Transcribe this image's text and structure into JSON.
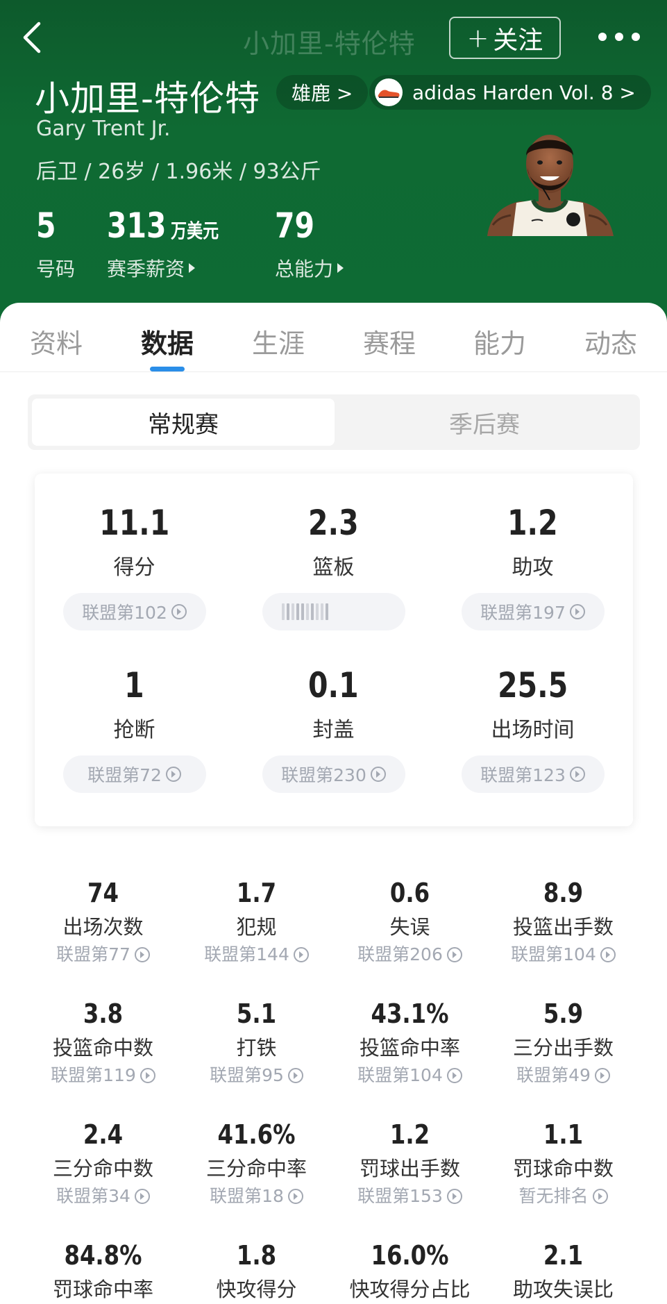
{
  "header": {
    "ghost_title": "小加里-特伦特",
    "follow_label": "关注",
    "player_name_cn": "小加里-特伦特",
    "team_chip": "雄鹿 >",
    "shoe_chip": "adidas Harden Vol. 8 >",
    "player_name_en": "Gary Trent Jr.",
    "meta": "后卫 / 26岁 / 1.96米 / 93公斤",
    "stats": {
      "number": {
        "value": "5",
        "label": "号码"
      },
      "salary": {
        "value": "313",
        "unit": "万美元",
        "label": "赛季薪资"
      },
      "rating": {
        "value": "79",
        "label": "总能力"
      }
    },
    "colors": {
      "bg": "#0e6b34",
      "accent": "#2a8ee8"
    }
  },
  "tabs": [
    "资料",
    "数据",
    "生涯",
    "赛程",
    "能力",
    "动态"
  ],
  "active_tab": "数据",
  "segments": {
    "regular": "常规赛",
    "playoffs": "季后赛"
  },
  "main_stats": [
    {
      "value": "11.1",
      "label": "得分",
      "rank": "联盟第102"
    },
    {
      "value": "2.3",
      "label": "篮板",
      "rank": ""
    },
    {
      "value": "1.2",
      "label": "助攻",
      "rank": "联盟第197"
    },
    {
      "value": "1",
      "label": "抢断",
      "rank": "联盟第72"
    },
    {
      "value": "0.1",
      "label": "封盖",
      "rank": "联盟第230"
    },
    {
      "value": "25.5",
      "label": "出场时间",
      "rank": "联盟第123"
    }
  ],
  "grid_stats": [
    {
      "value": "74",
      "label": "出场次数",
      "rank": "联盟第77"
    },
    {
      "value": "1.7",
      "label": "犯规",
      "rank": "联盟第144"
    },
    {
      "value": "0.6",
      "label": "失误",
      "rank": "联盟第206"
    },
    {
      "value": "8.9",
      "label": "投篮出手数",
      "rank": "联盟第104"
    },
    {
      "value": "3.8",
      "label": "投篮命中数",
      "rank": "联盟第119"
    },
    {
      "value": "5.1",
      "label": "打铁",
      "rank": "联盟第95"
    },
    {
      "value": "43.1%",
      "label": "投篮命中率",
      "rank": "联盟第104"
    },
    {
      "value": "5.9",
      "label": "三分出手数",
      "rank": "联盟第49"
    },
    {
      "value": "2.4",
      "label": "三分命中数",
      "rank": "联盟第34"
    },
    {
      "value": "41.6%",
      "label": "三分命中率",
      "rank": "联盟第18"
    },
    {
      "value": "1.2",
      "label": "罚球出手数",
      "rank": "联盟第153"
    },
    {
      "value": "1.1",
      "label": "罚球命中数",
      "rank": "暂无排名"
    },
    {
      "value": "84.8%",
      "label": "罚球命中率",
      "rank": ""
    },
    {
      "value": "1.8",
      "label": "快攻得分",
      "rank": ""
    },
    {
      "value": "16.0%",
      "label": "快攻得分占比",
      "rank": ""
    },
    {
      "value": "2.1",
      "label": "助攻失误比",
      "rank": ""
    }
  ]
}
